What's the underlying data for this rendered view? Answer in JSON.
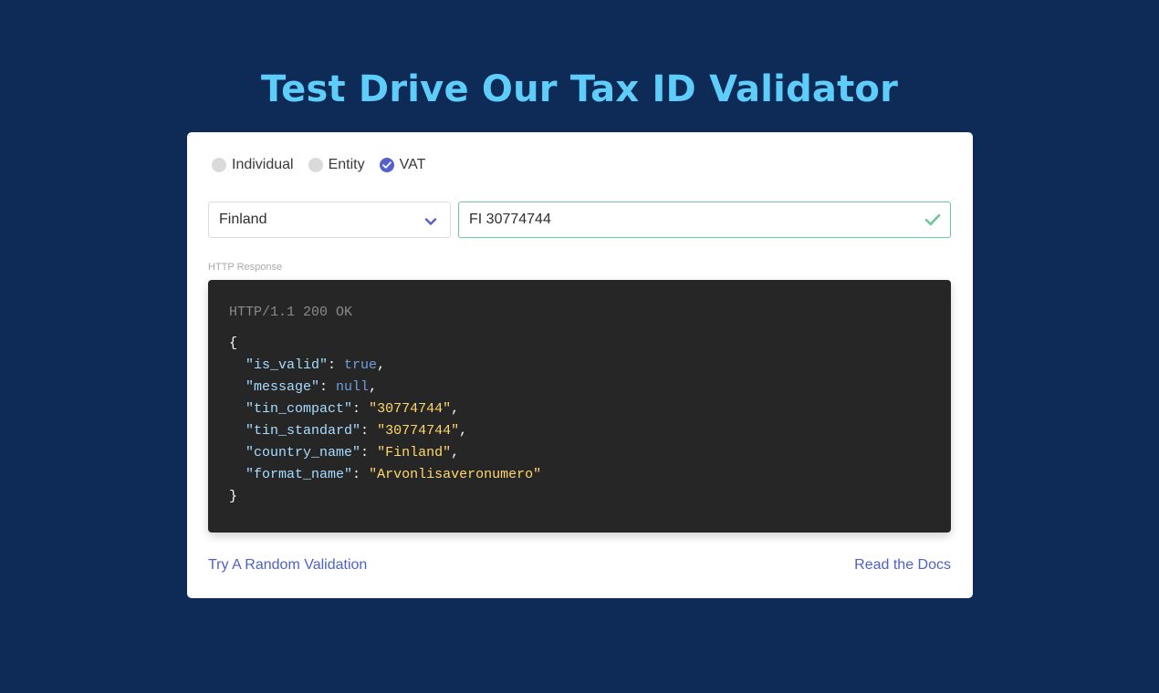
{
  "page": {
    "title": "Test Drive Our Tax ID Validator"
  },
  "type_options": [
    {
      "label": "Individual",
      "checked": false
    },
    {
      "label": "Entity",
      "checked": false
    },
    {
      "label": "VAT",
      "checked": true
    }
  ],
  "country_select": {
    "value": "Finland"
  },
  "tin_input": {
    "value": "FI 30774744",
    "status": "valid"
  },
  "response": {
    "label": "HTTP Response",
    "status_line": "HTTP/1.1 200 OK",
    "open_brace": "{",
    "close_brace": "}",
    "fields": [
      {
        "key": "\"is_valid\"",
        "value": "true",
        "kind": "literal",
        "sep": ","
      },
      {
        "key": "\"message\"",
        "value": "null",
        "kind": "literal",
        "sep": ","
      },
      {
        "key": "\"tin_compact\"",
        "value": "\"30774744\"",
        "kind": "string",
        "sep": ","
      },
      {
        "key": "\"tin_standard\"",
        "value": "\"30774744\"",
        "kind": "string",
        "sep": ","
      },
      {
        "key": "\"country_name\"",
        "value": "\"Finland\"",
        "kind": "string",
        "sep": ","
      },
      {
        "key": "\"format_name\"",
        "value": "\"Arvonlisaveronumero\"",
        "kind": "string",
        "sep": ""
      }
    ]
  },
  "footer": {
    "random_label": "Try A Random Validation",
    "docs_label": "Read the Docs"
  },
  "colors": {
    "background": "#0e2a56",
    "title": "#5fcdfa",
    "accent": "#5561c8",
    "valid": "#6fc79a",
    "link": "#4f61c4",
    "code_bg": "#262626",
    "json_key": "#a8dcff",
    "json_string": "#ffd86b",
    "json_literal": "#6f9fe0"
  },
  "icons": {
    "select": "chevron-down-icon",
    "valid": "check-icon",
    "radio_checked": "checkmark-icon"
  }
}
